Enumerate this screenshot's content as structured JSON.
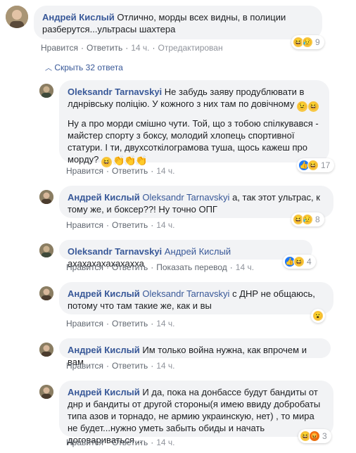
{
  "top_comment": {
    "author": "Андрей Кислый",
    "text": "Отлично, морды всех видны, в полиции разберутся...ультрасы шахтера",
    "actions": {
      "like": "Нравится",
      "reply": "Ответить",
      "time": "14 ч.",
      "edited": "Отредактирован"
    },
    "reaction_count": "9"
  },
  "hide_replies": "Скрыть 32 ответа",
  "replies": [
    {
      "author": "Oleksandr Tarnavskyi",
      "text1": "Не забудь заяву продублювати в лднрівську поліцію. У кожного з них там по довічному",
      "text2": "Ну а про морди смішно чути. Той, що з тобою спілкувався - майстер спорту з боксу, молодий хлопець спортивної статури. І ти, двухсоткілограмова туша, щось кажеш про морду?",
      "like": "Нравится",
      "reply": "Ответить",
      "time": "14 ч.",
      "reaction_count": "17"
    },
    {
      "author": "Андрей Кислый",
      "mention": "Oleksandr Tarnavskyi",
      "text": "а, так этот ультрас, к тому же, и боксер??! Ну точно ОПГ",
      "like": "Нравится",
      "reply": "Ответить",
      "time": "14 ч.",
      "reaction_count": "8"
    },
    {
      "author": "Oleksandr Tarnavskyi",
      "mention": "Андрей Кислый",
      "text": "ахахахахахахахха",
      "like": "Нравится",
      "reply": "Ответить",
      "translate": "Показать перевод",
      "time": "14 ч.",
      "reaction_count": "4"
    },
    {
      "author": "Андрей Кислый",
      "mention": "Oleksandr Tarnavskyi",
      "text": "с ДНР не общаюсь, потому что там такие же, как и вы",
      "like": "Нравится",
      "reply": "Ответить",
      "time": "14 ч."
    },
    {
      "author": "Андрей Кислый",
      "text": "Им только война нужна, как впрочем и вам",
      "like": "Нравится",
      "reply": "Ответить",
      "time": "14 ч."
    },
    {
      "author": "Андрей Кислый",
      "text": "И да, пока на донбассе будут бандиты от днр и бандиты от другой стороны(я имею ввиду добробаты типа азов и торнадо, не армию украинскую, нет) , то мира не будет...нужно уметь забыть обиды и начать договариваться...",
      "like": "Нравится",
      "reply": "Ответить",
      "time": "14 ч.",
      "reaction_count": "3"
    }
  ],
  "colors": {
    "link": "#385898",
    "bubble": "#f2f3f5",
    "like_blue": "#2078f4",
    "haha_yellow": "#f7c744",
    "angry_red": "#e9710f"
  }
}
